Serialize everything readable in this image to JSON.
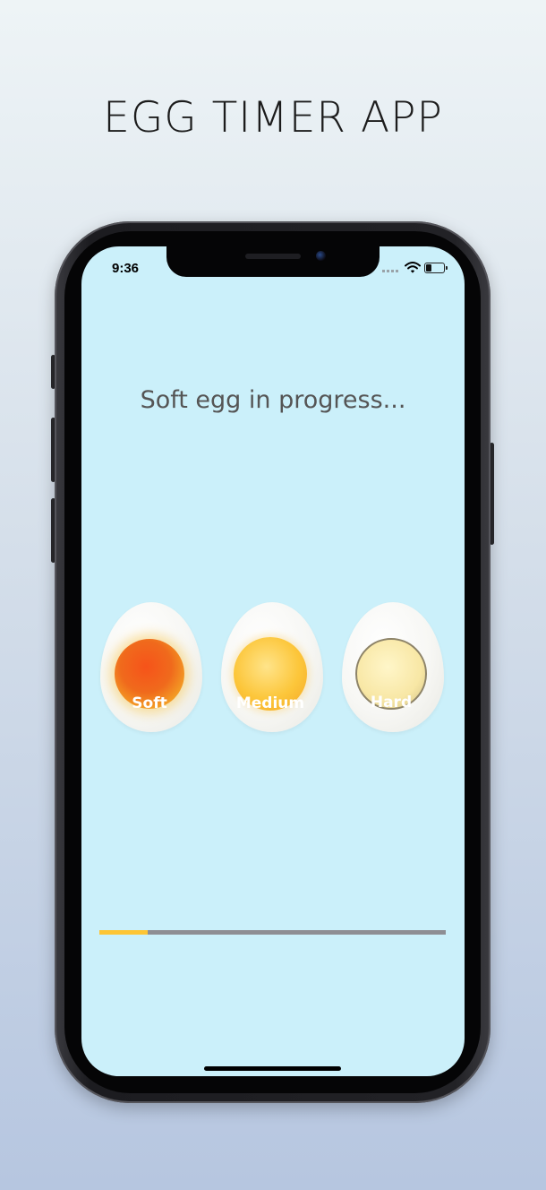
{
  "promo": {
    "title": "EGG TIMER APP"
  },
  "status_bar": {
    "time": "9:36",
    "icons": [
      "signal-icon",
      "wifi-icon",
      "battery-icon"
    ]
  },
  "main": {
    "status_text": "Soft egg in progress...",
    "eggs": [
      {
        "label": "Soft",
        "color": "#f06a1c"
      },
      {
        "label": "Medium",
        "color": "#fcc63a"
      },
      {
        "label": "Hard",
        "color": "#f8e7a5"
      }
    ],
    "progress": {
      "value": 0.14,
      "fill_color": "#fdc534",
      "track_color": "#8e8e93"
    }
  },
  "colors": {
    "screen_background": "#cbf0fa",
    "status_text": "#555555"
  }
}
